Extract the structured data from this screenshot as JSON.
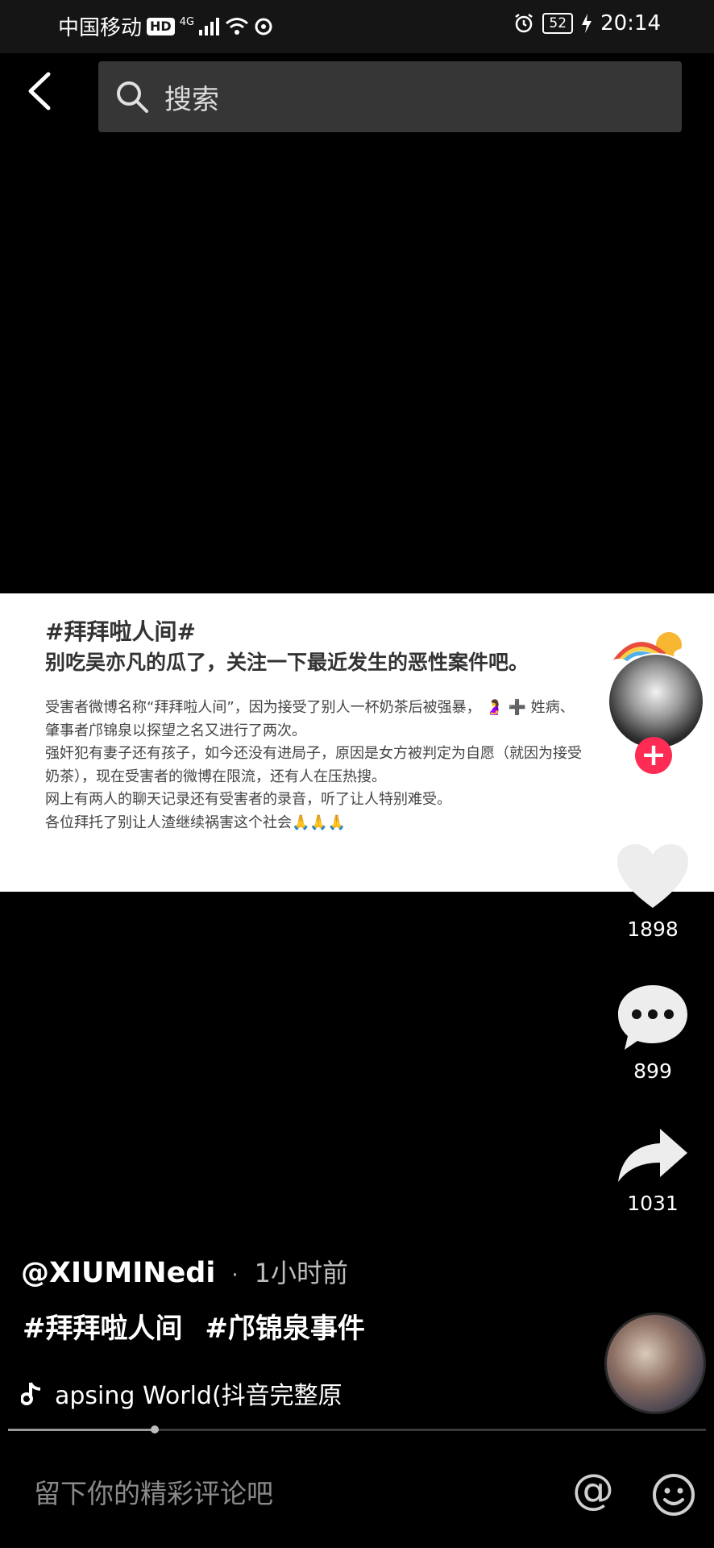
{
  "status_bar": {
    "carrier": "中国移动",
    "hd": "HD",
    "network": "4G",
    "battery": "52",
    "time": "20:14"
  },
  "search": {
    "placeholder": "搜索"
  },
  "video": {
    "title": "#拜拜啦人间#",
    "subtitle": "别吃吴亦凡的瓜了，关注一下最近发生的恶性案件吧。",
    "body": [
      "受害者微博名称“拜拜啦人间”，因为接受了别人一杯奶茶后被强暴， 🤰 ➕ 姓病、",
      "肇事者邝锦泉以探望之名又进行了两次。",
      "强奸犯有妻子还有孩子，如今还没有进局子，原因是女方被判定为自愿（就因为接受",
      "奶茶），现在受害者的微博在限流，还有人在压热搜。",
      "网上有两人的聊天记录还有受害者的录音，听了让人特别难受。",
      "各位拜托了别让人渣继续祸害这个社会🙏🙏🙏"
    ]
  },
  "actions": {
    "follow": "+",
    "likes": "1898",
    "comments": "899",
    "shares": "1031"
  },
  "post": {
    "author": "@XIUMINedi",
    "separator": "·",
    "time": "1小时前",
    "tags": [
      "#拜拜啦人间",
      "#邝锦泉事件"
    ],
    "music": "apsing  World(抖音完整原"
  },
  "progress": {
    "fraction": 0.21
  },
  "comment": {
    "placeholder": "留下你的精彩评论吧",
    "at": "@"
  }
}
